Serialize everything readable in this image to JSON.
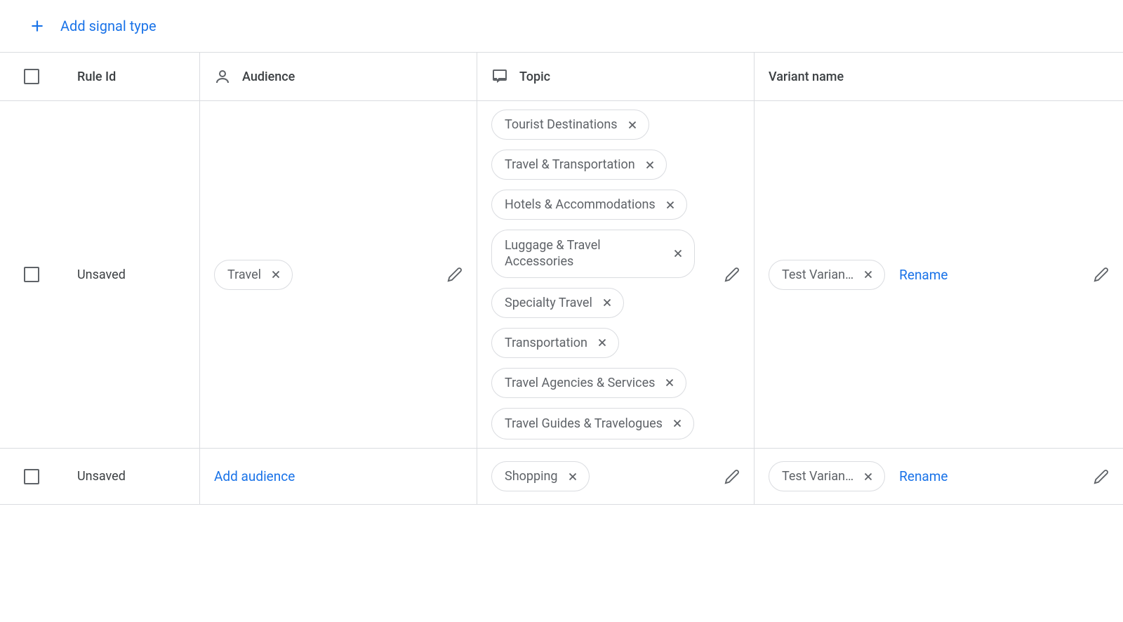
{
  "toolbar": {
    "add_signal_label": "Add signal type"
  },
  "headers": {
    "rule_id": "Rule Id",
    "audience": "Audience",
    "topic": "Topic",
    "variant_name": "Variant name"
  },
  "rows": [
    {
      "rule_id": "Unsaved",
      "audience": {
        "chips": [
          "Travel"
        ],
        "add_label": null
      },
      "topic": {
        "chips": [
          "Tourist Destinations",
          "Travel & Transportation",
          "Hotels & Accommodations",
          "Luggage & Travel Accessories",
          "Specialty Travel",
          "Transportation",
          "Travel Agencies & Services",
          "Travel Guides & Travelogues"
        ]
      },
      "variant": {
        "chip": "Test Varian…",
        "rename_label": "Rename"
      }
    },
    {
      "rule_id": "Unsaved",
      "audience": {
        "chips": [],
        "add_label": "Add audience"
      },
      "topic": {
        "chips": [
          "Shopping"
        ]
      },
      "variant": {
        "chip": "Test Varian…",
        "rename_label": "Rename"
      }
    }
  ]
}
